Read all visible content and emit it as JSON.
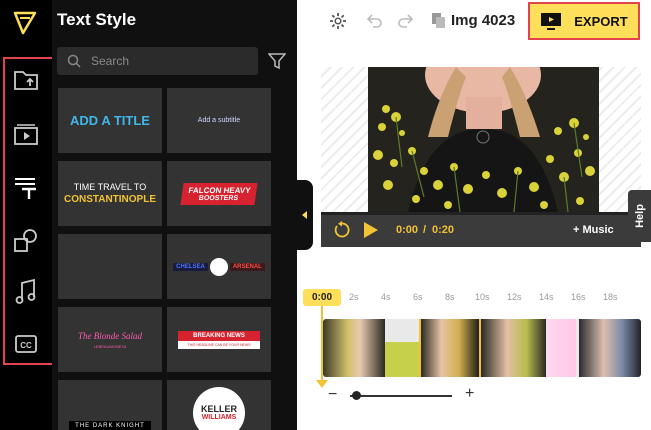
{
  "panel": {
    "title": "Text Style",
    "search_placeholder": "Search"
  },
  "tiles": {
    "add_title": "ADD A TITLE",
    "add_subtitle": "Add a subtitle",
    "time_travel_line1": "TIME TRAVEL TO",
    "time_travel_line2": "CONSTANTINOPLE",
    "falcon_line1": "FALCON HEAVY",
    "falcon_line2": "BOOSTERS",
    "chelsea": "CHELSEA",
    "arsenal": "ARSENAL",
    "blonde_salad": "The Blonde Salad",
    "blonde_sub": "LEBEAUMONETA",
    "breaking_news": "BREAKING NEWS",
    "breaking_sub": "THIS HEADLINE CAN BE YOUR NEWS",
    "dark_knight": "THE DARK KNIGHT",
    "keller_line1": "KELLER",
    "keller_line2": "WILLIAMS"
  },
  "toolbar": {
    "project_name": "Img 4023",
    "export_label": "EXPORT"
  },
  "player": {
    "time_current": "0:00",
    "time_separator": "/",
    "time_total": "0:20",
    "music_label": "+ Music",
    "help_label": "Help"
  },
  "timeline": {
    "playhead_time": "0:00",
    "ticks": [
      "2s",
      "4s",
      "6s",
      "8s",
      "10s",
      "12s",
      "14s",
      "16s",
      "18s"
    ],
    "zoom_minus": "−",
    "zoom_plus": "+"
  },
  "icons": {
    "rail": [
      "upload-folder-icon",
      "media-library-icon",
      "text-style-icon",
      "elements-icon",
      "music-note-icon",
      "closed-caption-icon"
    ],
    "toolbar": [
      "gear-icon",
      "undo-icon",
      "redo-icon",
      "duplicate-icon",
      "monitor-export-icon"
    ]
  },
  "colors": {
    "accent_yellow": "#ffde59",
    "highlight_red": "#e2434c",
    "title_blue": "#3fb7e8",
    "falcon_red": "#d6232f"
  }
}
